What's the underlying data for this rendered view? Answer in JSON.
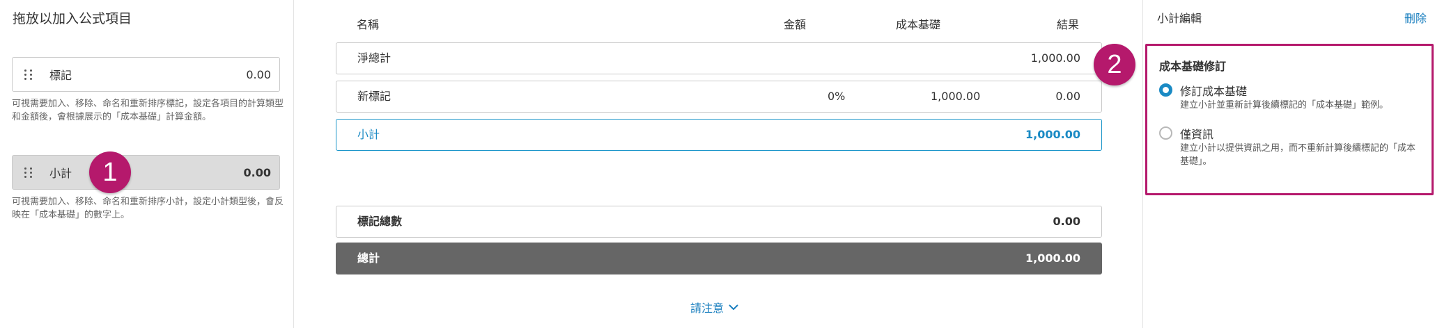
{
  "left": {
    "title": "拖放以加入公式項目",
    "items": [
      {
        "label": "標記",
        "value": "0.00",
        "desc": "可視需要加入、移除、命名和重新排序標記，設定各項目的計算類型和金額後，會根據展示的「成本基礎」計算金額。"
      },
      {
        "label": "小計",
        "value": "0.00",
        "desc": "可視需要加入、移除、命名和重新排序小計，設定小計類型後，會反映在「成本基礎」的數字上。"
      }
    ]
  },
  "badges": {
    "one": "1",
    "two": "2"
  },
  "center": {
    "headers": {
      "name": "名稱",
      "amount": "金額",
      "cost_basis": "成本基礎",
      "result": "結果"
    },
    "rows": [
      {
        "name": "淨總計",
        "amount": "",
        "cost_basis": "",
        "result": "1,000.00"
      },
      {
        "name": "新標記",
        "amount": "0%",
        "cost_basis": "1,000.00",
        "result": "0.00"
      },
      {
        "name": "小計",
        "amount": "",
        "cost_basis": "",
        "result": "1,000.00"
      }
    ],
    "markup_total": {
      "name": "標記總數",
      "result": "0.00"
    },
    "grand_total": {
      "name": "總計",
      "result": "1,000.00"
    },
    "notice": "請注意"
  },
  "right": {
    "title": "小計編輯",
    "delete": "刪除",
    "section_title": "成本基礎修訂",
    "options": [
      {
        "label": "修訂成本基礎",
        "desc": "建立小計並重新計算後續標記的「成本基礎」範例。",
        "selected": true
      },
      {
        "label": "僅資訊",
        "desc": "建立小計以提供資訊之用，而不重新計算後續標記的「成本基礎」。",
        "selected": false
      }
    ]
  },
  "colors": {
    "accent": "#1a8ac4",
    "highlight": "#b5196c",
    "dark_row": "#666666"
  }
}
